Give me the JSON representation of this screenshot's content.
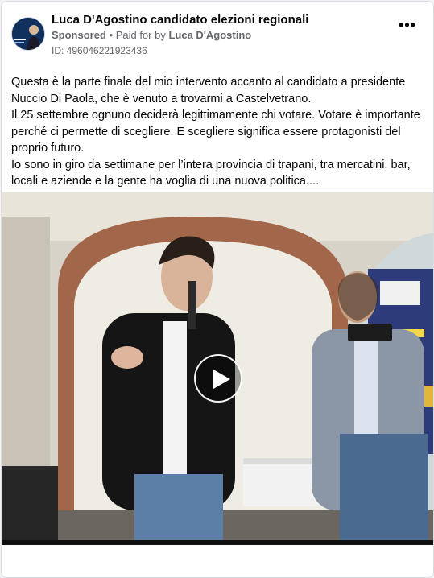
{
  "post": {
    "page_name": "Luca D'Agostino candidato elezioni regionali",
    "sponsored_label": "Sponsored",
    "separator": " • ",
    "paid_for_prefix": "Paid for by ",
    "payer": "Luca D'Agostino",
    "ad_id": "ID: 496046221923436",
    "more_icon": "more-horizontal-icon",
    "text": {
      "p1": "Questa è la parte finale del mio intervento accanto al candidato a presidente Nuccio Di Paola, che è venuto a trovarmi a Castelvetrano.",
      "p2": "Il 25 settembre ognuno deciderà legittimamente chi votare. Votare è importante perché ci permette di scegliere. E scegliere significa essere protagonisti del proprio futuro.",
      "p3": "Io sono in giro da settimane per l’intera provincia di trapani, tra mercatini, bar, locali e aziende e la gente ha voglia di una nuova politica...."
    }
  },
  "video": {
    "play_icon": "play-icon"
  }
}
